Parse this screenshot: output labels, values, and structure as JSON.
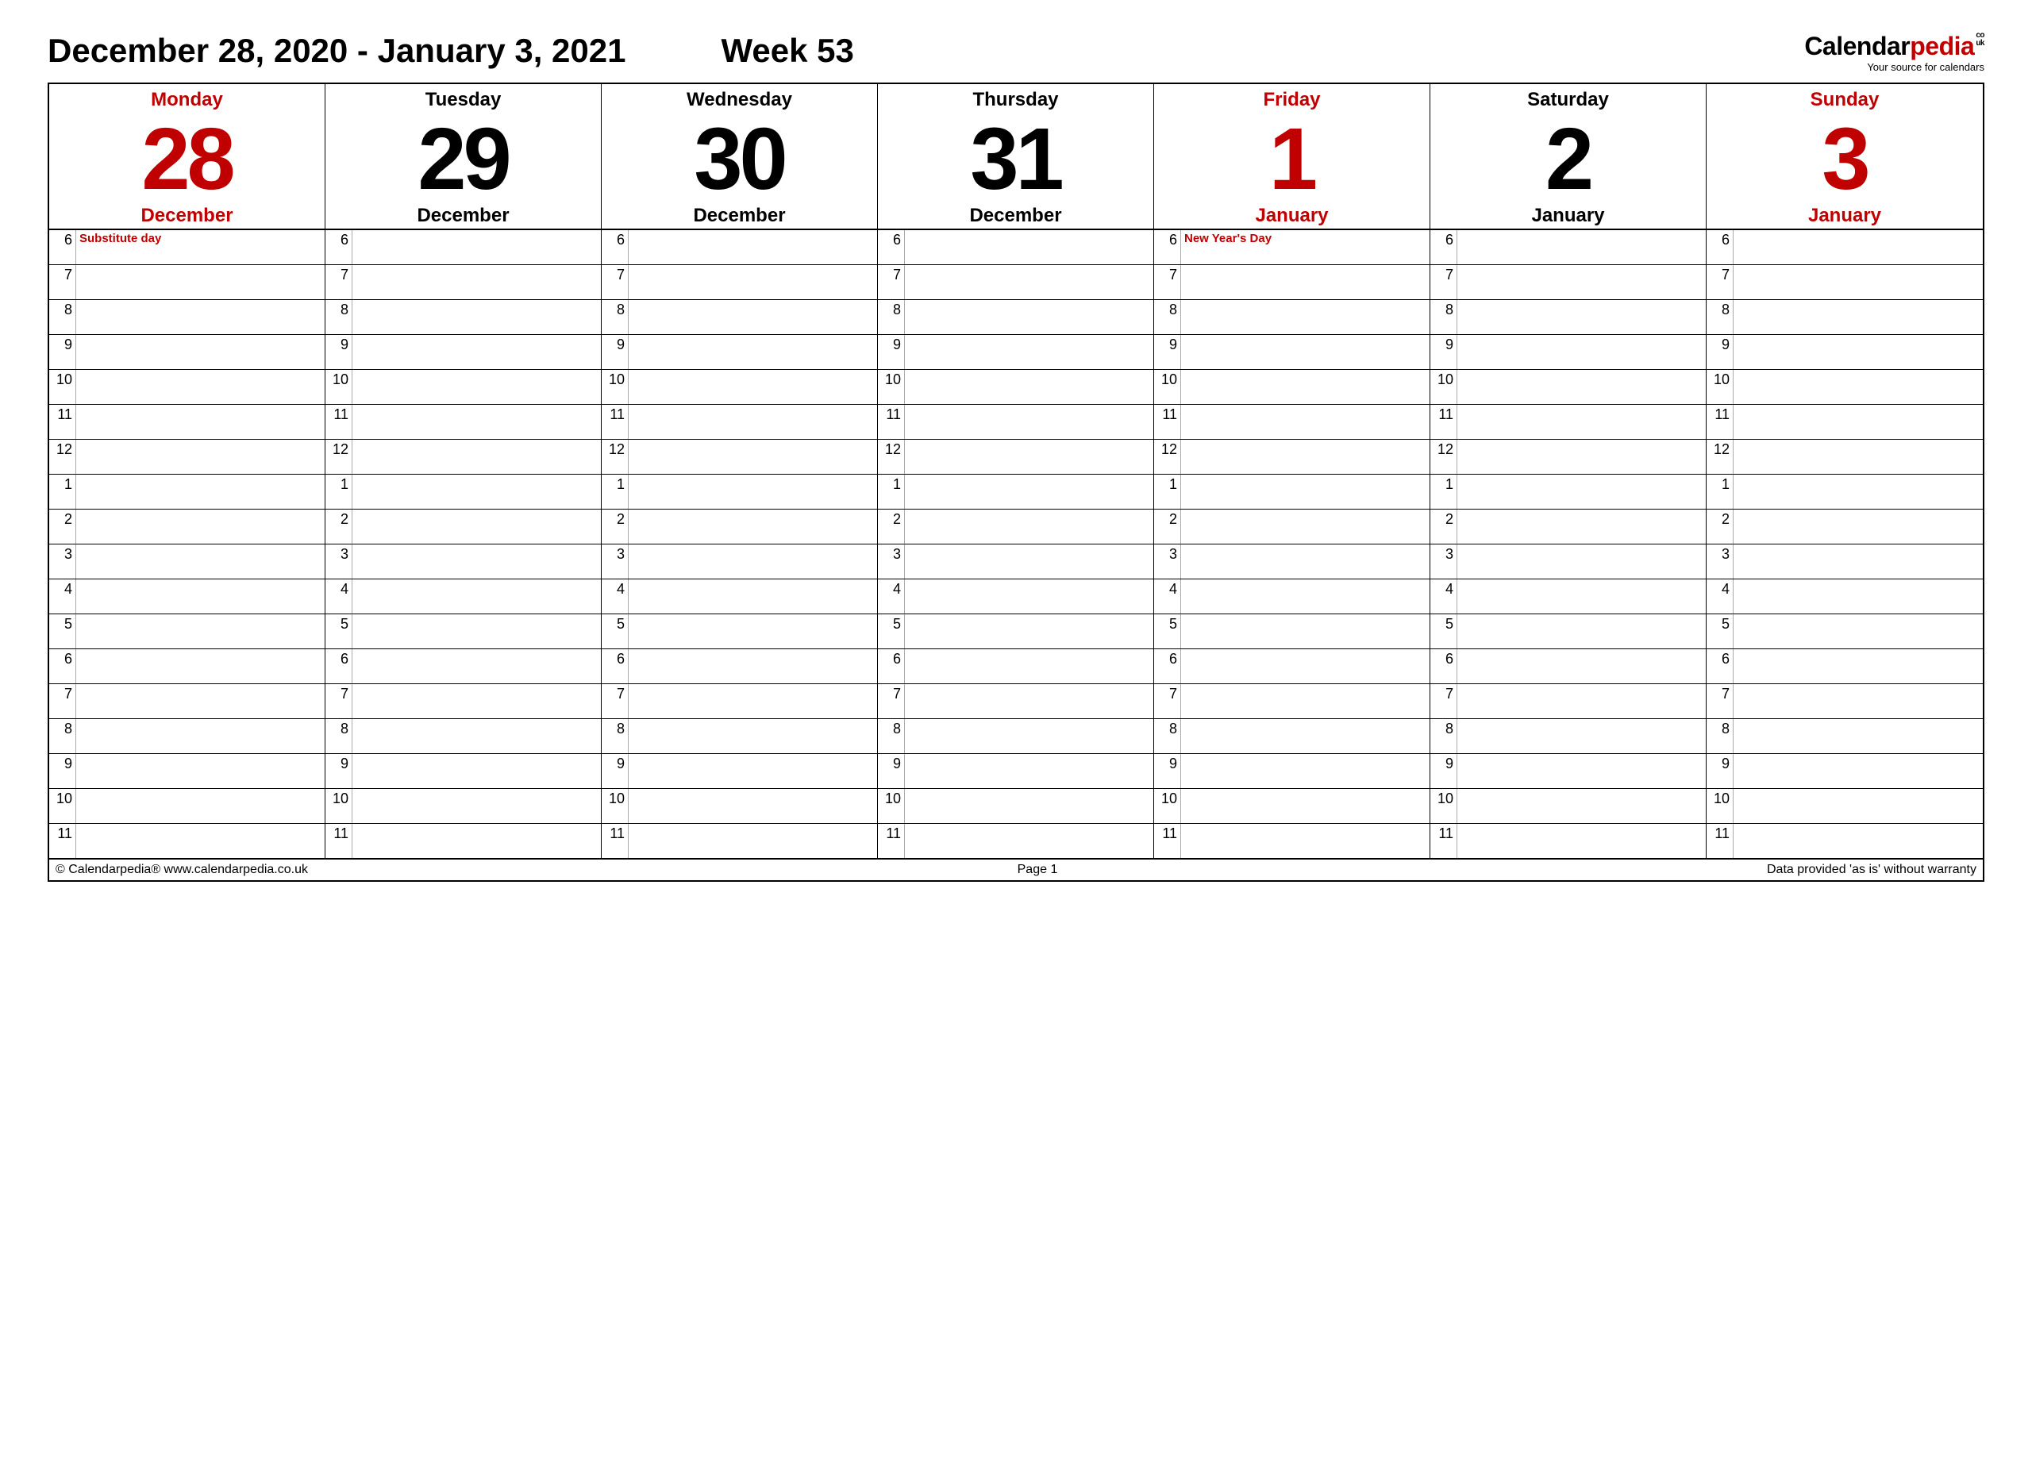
{
  "header": {
    "date_range": "December 28, 2020 - January 3, 2021",
    "week_label": "Week 53",
    "logo_part1": "Calendar",
    "logo_part2": "pedia",
    "logo_tld_top": "co",
    "logo_tld_bot": "uk",
    "logo_tag": "Your source for calendars"
  },
  "hours": [
    "6",
    "7",
    "8",
    "9",
    "10",
    "11",
    "12",
    "1",
    "2",
    "3",
    "4",
    "5",
    "6",
    "7",
    "8",
    "9",
    "10",
    "11"
  ],
  "days": [
    {
      "name": "Monday",
      "num": "28",
      "month": "December",
      "red": true,
      "note": "Substitute day"
    },
    {
      "name": "Tuesday",
      "num": "29",
      "month": "December",
      "red": false,
      "note": ""
    },
    {
      "name": "Wednesday",
      "num": "30",
      "month": "December",
      "red": false,
      "note": ""
    },
    {
      "name": "Thursday",
      "num": "31",
      "month": "December",
      "red": false,
      "note": ""
    },
    {
      "name": "Friday",
      "num": "1",
      "month": "January",
      "red": true,
      "note": "New Year's Day"
    },
    {
      "name": "Saturday",
      "num": "2",
      "month": "January",
      "red": false,
      "note": ""
    },
    {
      "name": "Sunday",
      "num": "3",
      "month": "January",
      "red": true,
      "note": ""
    }
  ],
  "footer": {
    "left": "© Calendarpedia®   www.calendarpedia.co.uk",
    "center": "Page 1",
    "right": "Data provided 'as is' without warranty"
  }
}
